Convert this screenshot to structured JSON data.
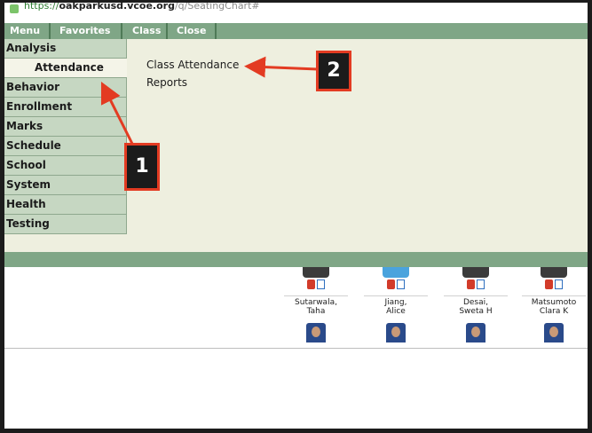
{
  "browser": {
    "url_protocol": "https://",
    "url_host": "oakparkusd.vcoe.org",
    "url_path": "/q/SeatingChart#"
  },
  "menubar": {
    "items": [
      "Menu",
      "Favorites",
      "Class",
      "Close"
    ]
  },
  "sidebar": {
    "items": [
      "Analysis",
      "Attendance",
      "Behavior",
      "Enrollment",
      "Marks",
      "Schedule",
      "School",
      "System",
      "Health",
      "Testing"
    ],
    "active": "Attendance"
  },
  "submenu": {
    "links": [
      "Class Attendance",
      "Reports"
    ]
  },
  "roster": {
    "students": [
      {
        "name_line1": "Sutarwala,",
        "name_line2": "Taha"
      },
      {
        "name_line1": "Jiang,",
        "name_line2": "Alice"
      },
      {
        "name_line1": "Desai,",
        "name_line2": "Sweta H"
      },
      {
        "name_line1": "Matsumoto",
        "name_line2": "Clara K"
      }
    ]
  },
  "annotations": [
    {
      "label": "1"
    },
    {
      "label": "2"
    }
  ],
  "colors": {
    "menubar": "#7fa686",
    "sidebar_item": "#c6d7c2",
    "panel": "#eeefdf",
    "callout_border": "#e33b22"
  }
}
